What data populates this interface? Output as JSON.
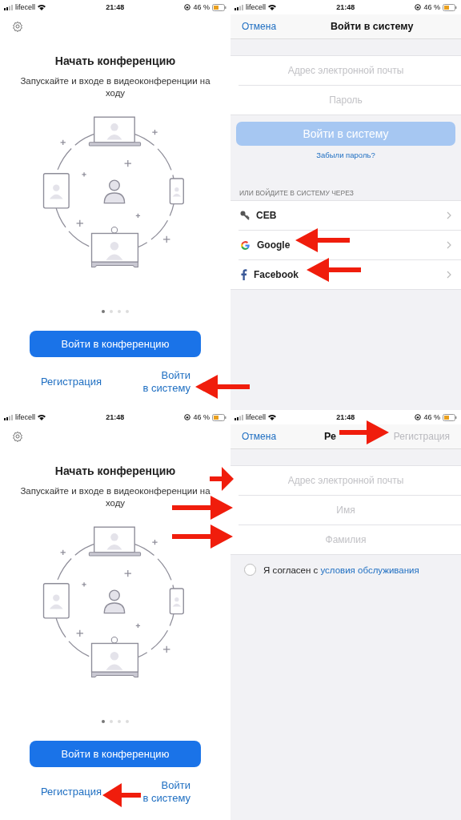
{
  "panels": [
    {
      "kind": "welcome",
      "status_bar": {
        "carrier": "lifecell",
        "time": "21:48",
        "battery": "46 %"
      },
      "title": "Начать конференцию",
      "subtitle": "Запускайте и входе в видеоконференции на ходу",
      "page_dots": [
        {
          "selected": true
        },
        {
          "selected": false
        },
        {
          "selected": false
        },
        {
          "selected": false
        }
      ],
      "join_button": "Войти в конференцию",
      "signup_link": "Регистрация",
      "signin_link": [
        "Войти",
        "в систему"
      ]
    },
    {
      "kind": "signin",
      "status_bar": {
        "carrier": "lifecell",
        "time": "21:48",
        "battery": "46 %"
      },
      "cancel": "Отмена",
      "title": "Войти в систему",
      "fields": [
        {
          "placeholder": "Адрес электронной почты"
        },
        {
          "placeholder": "Пароль"
        }
      ],
      "submit_button": {
        "label": "Войти в систему",
        "disabled": true
      },
      "forgot_link": "Забыли пароль?",
      "section_label": "ИЛИ ВОЙДИТЕ В СИСТЕМУ ЧЕРЕЗ",
      "providers": [
        {
          "kind": "key",
          "label": "CEB"
        },
        {
          "kind": "google",
          "label": "Google"
        },
        {
          "kind": "facebook",
          "label": "Facebook"
        }
      ]
    },
    {
      "kind": "welcome",
      "status_bar": {
        "carrier": "lifecell",
        "time": "21:48",
        "battery": "46 %"
      },
      "title": "Начать конференцию",
      "subtitle": "Запускайте и входе в видеоконференции на ходу",
      "page_dots": [
        {
          "selected": true
        },
        {
          "selected": false
        },
        {
          "selected": false
        },
        {
          "selected": false
        }
      ],
      "join_button": "Войти в конференцию",
      "signup_link": "Регистрация",
      "signin_link": [
        "Войти",
        "в систему"
      ]
    },
    {
      "kind": "signup",
      "status_bar": {
        "carrier": "lifecell",
        "time": "21:48",
        "battery": "46 %"
      },
      "cancel": "Отмена",
      "title": "Ре",
      "submit": {
        "label": "Регистрация",
        "disabled": true
      },
      "fields": [
        {
          "placeholder": "Адрес электронной почты"
        },
        {
          "placeholder": "Имя"
        },
        {
          "placeholder": "Фамилия"
        }
      ],
      "agreement": {
        "checked": false,
        "text": "Я согласен с ",
        "link": "условия обслуживания"
      }
    }
  ]
}
